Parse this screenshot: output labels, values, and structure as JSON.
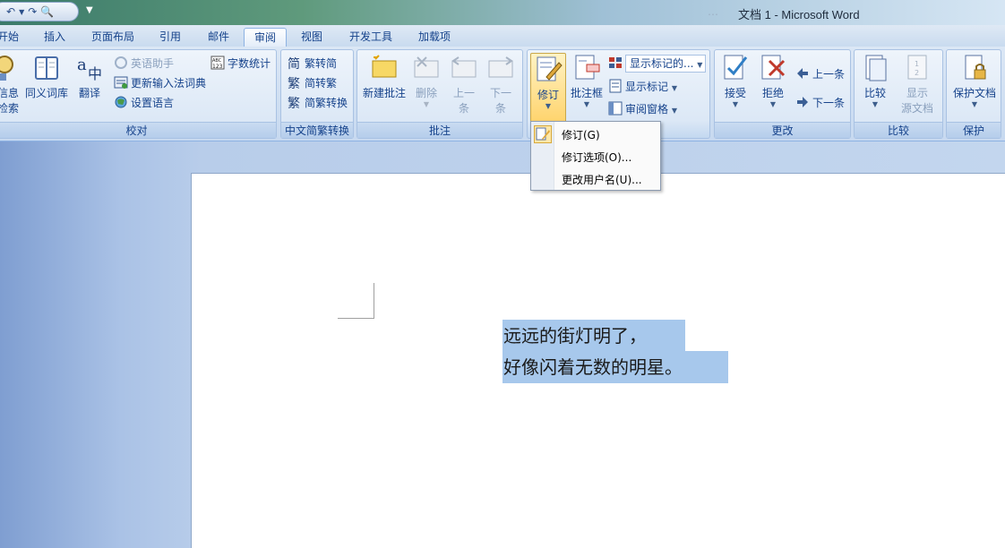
{
  "window": {
    "title": "文档 1 - Microsoft Word",
    "title_ghost": "…"
  },
  "quick_access": {
    "undo_icon": "undo-icon",
    "redo_icon": "redo-icon",
    "preview_icon": "print-preview-icon",
    "more": "▼"
  },
  "tabs": [
    {
      "label": "开始"
    },
    {
      "label": "插入"
    },
    {
      "label": "页面布局"
    },
    {
      "label": "引用"
    },
    {
      "label": "邮件"
    },
    {
      "label": "审阅",
      "active": true
    },
    {
      "label": "视图"
    },
    {
      "label": "开发工具"
    },
    {
      "label": "加载项"
    }
  ],
  "ribbon": {
    "proofing": {
      "label": "校对",
      "research_line1": "信息",
      "research_line2": "检索",
      "thesaurus": "同义词库",
      "translate": "翻译",
      "english_assistant": "英语助手",
      "update_ime_dict": "更新输入法词典",
      "set_language": "设置语言",
      "word_count": "字数统计"
    },
    "chinese_convert": {
      "label": "中文简繁转换",
      "to_simplified": "繁转简",
      "to_traditional": "简转繁",
      "convert": "简繁转换"
    },
    "comments": {
      "label": "批注",
      "new_comment": "新建批注",
      "delete_line1": "删除",
      "prev_line1": "上一",
      "prev_line2": "条",
      "next_line1": "下一",
      "next_line2": "条"
    },
    "tracking": {
      "track_changes": "修订",
      "balloons": "批注框",
      "display_markup": "显示标记的...",
      "show_markup": "显示标记",
      "reviewing_pane": "审阅窗格"
    },
    "changes": {
      "label": "更改",
      "accept": "接受",
      "reject": "拒绝",
      "previous": "上一条",
      "next": "下一条"
    },
    "compare": {
      "label": "比较",
      "compare": "比较",
      "show_source_line1": "显示",
      "show_source_line2": "源文档"
    },
    "protect": {
      "label": "保护",
      "protect_doc": "保护文档"
    }
  },
  "track_menu": {
    "items": [
      {
        "label": "修订(G)"
      },
      {
        "label": "修订选项(O)..."
      },
      {
        "label": "更改用户名(U)..."
      }
    ]
  },
  "document": {
    "line1": "远远的街灯明了，",
    "line2": "好像闪着无数的明星。"
  }
}
